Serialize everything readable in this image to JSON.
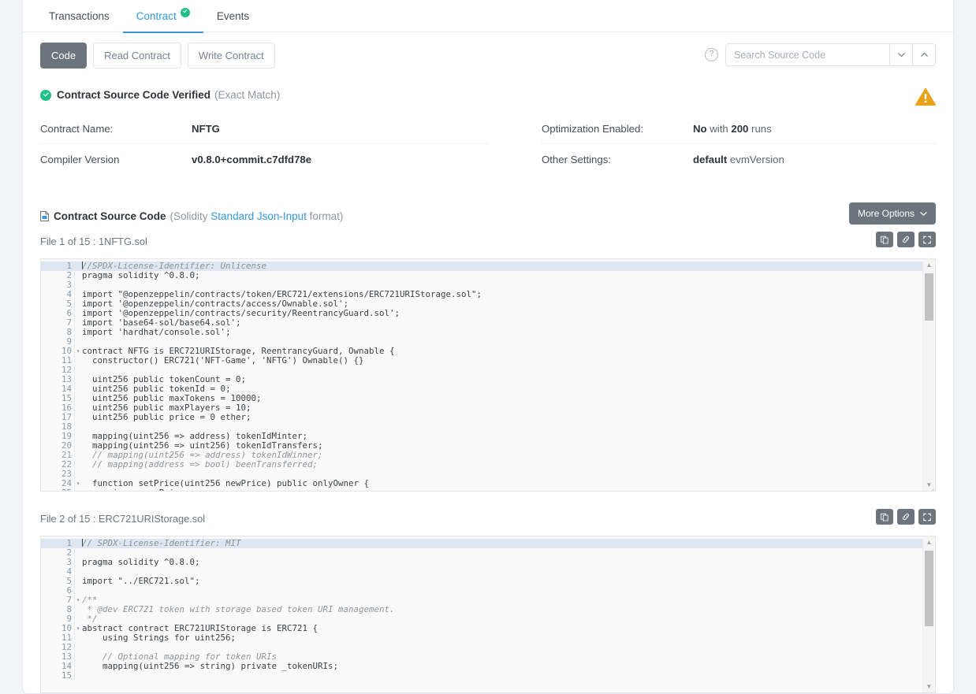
{
  "tabs": [
    {
      "label": "Transactions",
      "active": false,
      "verified": false
    },
    {
      "label": "Contract",
      "active": true,
      "verified": true
    },
    {
      "label": "Events",
      "active": false,
      "verified": false
    }
  ],
  "toolbar": {
    "code_label": "Code",
    "read_contract_label": "Read Contract",
    "write_contract_label": "Write Contract",
    "help_glyph": "?",
    "search_placeholder": "Search Source Code",
    "search_value": "",
    "chevron_down_glyph": "⌄",
    "chevron_up_glyph": "⌃"
  },
  "verified": {
    "title": "Contract Source Code Verified",
    "subtitle": "(Exact Match)"
  },
  "info": {
    "left": [
      {
        "label": "Contract Name:",
        "value_bold": "NFTG",
        "value_rest": ""
      },
      {
        "label": "Compiler Version",
        "value_bold": "v0.8.0+commit.c7dfd78e",
        "value_rest": ""
      }
    ],
    "right": [
      {
        "label": "Optimization Enabled:",
        "value_bold": "No",
        "mid": " with ",
        "value_bold2": "200",
        "value_rest": " runs"
      },
      {
        "label": "Other Settings:",
        "value_bold": "default",
        "value_rest": " evmVersion"
      }
    ]
  },
  "source": {
    "title": "Contract Source Code",
    "sub_prefix": "(Solidity ",
    "sub_link": "Standard Json-Input",
    "sub_suffix": " format)",
    "more_options_label": "More Options",
    "more_options_caret": "⌄"
  },
  "files": [
    {
      "label": "File 1 of 15 : 1NFTG.sol",
      "lines": [
        {
          "n": 1,
          "fold": false,
          "text": "//SPDX-License-Identifier: Unlicense",
          "style": "cmt",
          "caret": true
        },
        {
          "n": 2,
          "fold": false,
          "text": "pragma solidity ^0.8.0;"
        },
        {
          "n": 3,
          "fold": false,
          "text": ""
        },
        {
          "n": 4,
          "fold": false,
          "text": "import \"@openzeppelin/contracts/token/ERC721/extensions/ERC721URIStorage.sol\";"
        },
        {
          "n": 5,
          "fold": false,
          "text": "import '@openzeppelin/contracts/access/Ownable.sol';"
        },
        {
          "n": 6,
          "fold": false,
          "text": "import '@openzeppelin/contracts/security/ReentrancyGuard.sol';"
        },
        {
          "n": 7,
          "fold": false,
          "text": "import 'base64-sol/base64.sol';"
        },
        {
          "n": 8,
          "fold": false,
          "text": "import 'hardhat/console.sol';"
        },
        {
          "n": 9,
          "fold": false,
          "text": ""
        },
        {
          "n": 10,
          "fold": true,
          "text": "contract NFTG is ERC721URIStorage, ReentrancyGuard, Ownable {"
        },
        {
          "n": 11,
          "fold": false,
          "text": "  constructor() ERC721('NFT-Game', 'NFTG') Ownable() {}"
        },
        {
          "n": 12,
          "fold": false,
          "text": ""
        },
        {
          "n": 13,
          "fold": false,
          "text": "  uint256 public tokenCount = 0;"
        },
        {
          "n": 14,
          "fold": false,
          "text": "  uint256 public tokenId = 0;"
        },
        {
          "n": 15,
          "fold": false,
          "text": "  uint256 public maxTokens = 10000;"
        },
        {
          "n": 16,
          "fold": false,
          "text": "  uint256 public maxPlayers = 10;"
        },
        {
          "n": 17,
          "fold": false,
          "text": "  uint256 public price = 0 ether;"
        },
        {
          "n": 18,
          "fold": false,
          "text": ""
        },
        {
          "n": 19,
          "fold": false,
          "text": "  mapping(uint256 => address) tokenIdMinter;"
        },
        {
          "n": 20,
          "fold": false,
          "text": "  mapping(uint256 => uint256) tokenIdTransfers;"
        },
        {
          "n": 21,
          "fold": false,
          "text": "  // mapping(uint256 => address) tokenIdWinner;",
          "style": "cmt"
        },
        {
          "n": 22,
          "fold": false,
          "text": "  // mapping(address => bool) beenTransferred;",
          "style": "cmt"
        },
        {
          "n": 23,
          "fold": false,
          "text": ""
        },
        {
          "n": 24,
          "fold": true,
          "text": "  function setPrice(uint256 newPrice) public onlyOwner {"
        },
        {
          "n": 25,
          "fold": false,
          "text": "    price = newPrice;"
        }
      ]
    },
    {
      "label": "File 2 of 15 : ERC721URIStorage.sol",
      "lines": [
        {
          "n": 1,
          "fold": false,
          "text": "// SPDX-License-Identifier: MIT",
          "style": "cmt",
          "caret": true
        },
        {
          "n": 2,
          "fold": false,
          "text": ""
        },
        {
          "n": 3,
          "fold": false,
          "text": "pragma solidity ^0.8.0;"
        },
        {
          "n": 4,
          "fold": false,
          "text": ""
        },
        {
          "n": 5,
          "fold": false,
          "text": "import \"../ERC721.sol\";"
        },
        {
          "n": 6,
          "fold": false,
          "text": ""
        },
        {
          "n": 7,
          "fold": true,
          "text": "/**",
          "style": "cmt"
        },
        {
          "n": 8,
          "fold": false,
          "text": " * @dev ERC721 token with storage based token URI management.",
          "style": "cmt"
        },
        {
          "n": 9,
          "fold": false,
          "text": " */",
          "style": "cmt"
        },
        {
          "n": 10,
          "fold": true,
          "text": "abstract contract ERC721URIStorage is ERC721 {"
        },
        {
          "n": 11,
          "fold": false,
          "text": "    using Strings for uint256;"
        },
        {
          "n": 12,
          "fold": false,
          "text": ""
        },
        {
          "n": 13,
          "fold": false,
          "text": "    // Optional mapping for token URIs",
          "style": "cmt"
        },
        {
          "n": 14,
          "fold": false,
          "text": "    mapping(uint256 => string) private _tokenURIs;"
        },
        {
          "n": 15,
          "fold": false,
          "text": ""
        }
      ]
    }
  ],
  "icon_buttons": [
    {
      "name": "copy-icon",
      "title": "Copy"
    },
    {
      "name": "link-icon",
      "title": "Link"
    },
    {
      "name": "expand-icon",
      "title": "Expand"
    }
  ],
  "colors": {
    "accent_blue": "#3498db",
    "verified_green": "#21c08b",
    "warning_orange": "#e8a317",
    "btn_grey": "#6c757d",
    "active_line": "#dee6f0"
  }
}
